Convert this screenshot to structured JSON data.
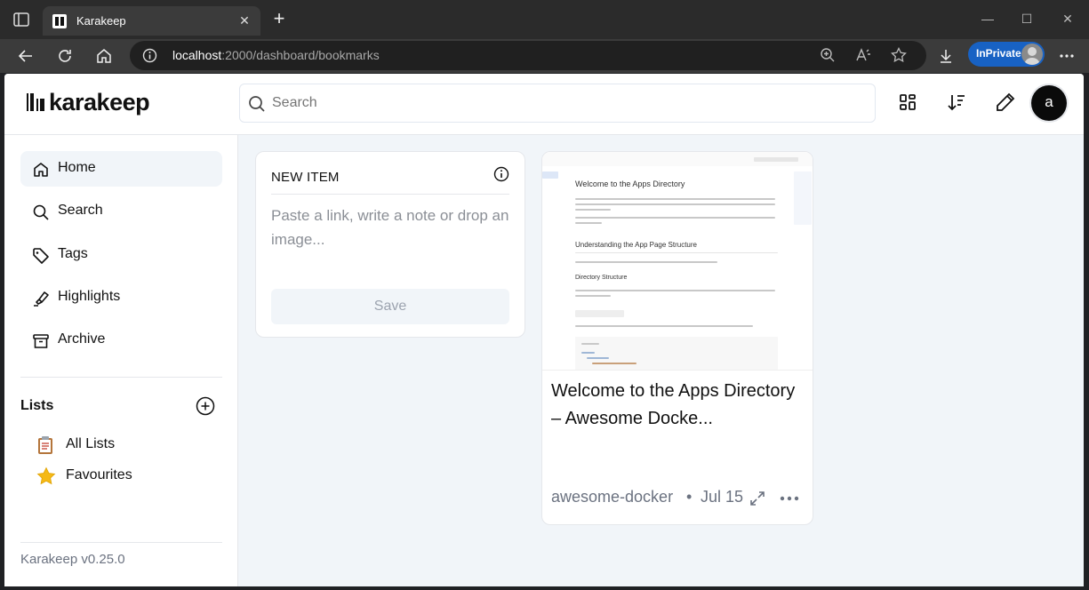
{
  "browser": {
    "tab_title": "Karakeep",
    "url_host": "localhost",
    "url_path": ":2000/dashboard/bookmarks",
    "inprivate_label": "InPrivate"
  },
  "app": {
    "logo_text": "karakeep",
    "search_placeholder": "Search",
    "avatar_letter": "a"
  },
  "sidebar": {
    "items": [
      {
        "label": "Home",
        "icon": "home-icon"
      },
      {
        "label": "Search",
        "icon": "search-icon"
      },
      {
        "label": "Tags",
        "icon": "tag-icon"
      },
      {
        "label": "Highlights",
        "icon": "highlighter-icon"
      },
      {
        "label": "Archive",
        "icon": "archive-icon"
      }
    ],
    "lists_title": "Lists",
    "lists": [
      {
        "label": "All Lists",
        "emoji": "clipboard"
      },
      {
        "label": "Favourites",
        "emoji": "star"
      }
    ],
    "version": "Karakeep v0.25.0"
  },
  "new_item": {
    "title": "NEW ITEM",
    "placeholder": "Paste a link, write a note or drop an image...",
    "save_label": "Save"
  },
  "bookmark": {
    "title": "Welcome to the Apps Directory – Awesome Docke...",
    "domain": "awesome-docker",
    "separator": "•",
    "date": "Jul 15",
    "preview": {
      "heading": "Welcome to the Apps Directory",
      "section1": "Understanding the App Page Structure",
      "section2": "Directory Structure",
      "code": "docker-compose.yml"
    }
  },
  "colors": {
    "app_bg": "#f1f5f9",
    "browser_frame": "#2b2b2b",
    "inprivate_blue": "#1862c4"
  }
}
